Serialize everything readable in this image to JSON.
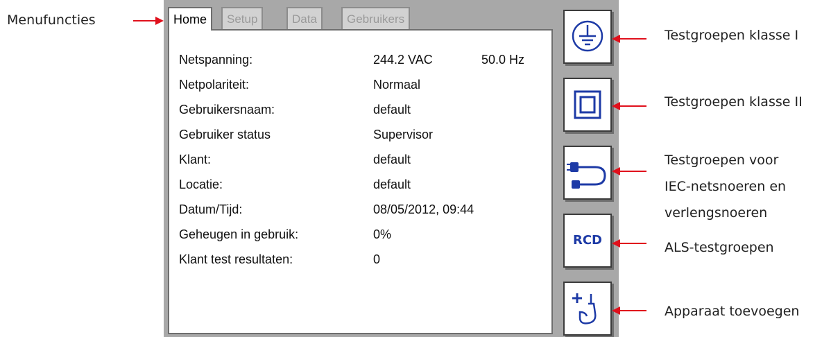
{
  "annotations": {
    "menu": "Menufuncties",
    "class1": "Testgroepen klasse I",
    "class2": "Testgroepen klasse II",
    "iec_line1": "Testgroepen voor",
    "iec_line2": "IEC-netsnoeren en",
    "iec_line3": "verlengsnoeren",
    "rcd": "ALS-testgroepen",
    "add": "Apparaat toevoegen"
  },
  "tabs": [
    {
      "label": "Home",
      "active": true
    },
    {
      "label": "Setup",
      "active": false
    },
    {
      "label": "Data",
      "active": false
    },
    {
      "label": "Gebruikers",
      "active": false
    }
  ],
  "rows": [
    {
      "label": "Netspanning:",
      "value": "244.2 VAC",
      "value2": "50.0 Hz"
    },
    {
      "label": "Netpolariteit:",
      "value": "Normaal"
    },
    {
      "label": "Gebruikersnaam:",
      "value": "default"
    },
    {
      "label": "Gebruiker status",
      "value": "Supervisor"
    },
    {
      "label": "Klant:",
      "value": "default"
    },
    {
      "label": "Locatie:",
      "value": "default"
    },
    {
      "label": "Datum/Tijd:",
      "value": "08/05/2012, 09:44"
    },
    {
      "label": "Geheugen in gebruik:",
      "value": "0%"
    },
    {
      "label": "Klant test resultaten:",
      "value": "0"
    }
  ],
  "side_buttons": {
    "class1_icon": "earth-ground-icon",
    "class2_icon": "double-insulation-icon",
    "iec_icon": "iec-lead-icon",
    "rcd_label": "RCD",
    "add_icon": "add-appliance-icon"
  },
  "colors": {
    "arrow": "#e0101c",
    "icon_blue": "#1d3aa6",
    "device_frame": "#a8a8a8"
  }
}
